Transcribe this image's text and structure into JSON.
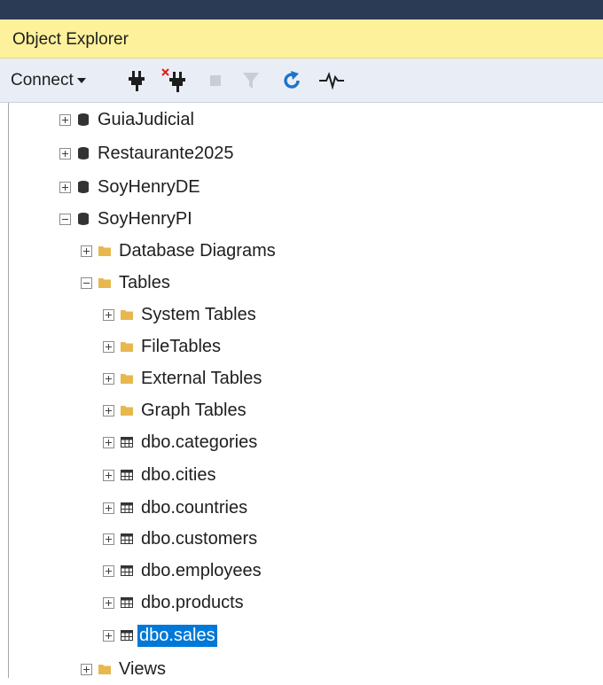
{
  "panel": {
    "title": "Object Explorer"
  },
  "toolbar": {
    "connect_label": "Connect",
    "icons": [
      "connect-plug-icon",
      "disconnect-plug-icon",
      "stop-icon",
      "filter-icon",
      "refresh-icon",
      "activity-monitor-icon"
    ]
  },
  "tree": {
    "db1": "GuiaJudicial",
    "db2": "Restaurante2025",
    "db3": "SoyHenryDE",
    "db4": "SoyHenryPI",
    "folder_diagrams": "Database Diagrams",
    "folder_tables": "Tables",
    "sub_system": "System Tables",
    "sub_file": "FileTables",
    "sub_external": "External Tables",
    "sub_graph": "Graph Tables",
    "t_categories": "dbo.categories",
    "t_cities": "dbo.cities",
    "t_countries": "dbo.countries",
    "t_customers": "dbo.customers",
    "t_employees": "dbo.employees",
    "t_products": "dbo.products",
    "t_sales": "dbo.sales",
    "folder_views": "Views"
  },
  "colors": {
    "header_bg": "#fdf19b",
    "toolbar_bg": "#e9eef6",
    "selection": "#0078d7",
    "folder": "#e8b74e",
    "refresh": "#1e74c9"
  }
}
